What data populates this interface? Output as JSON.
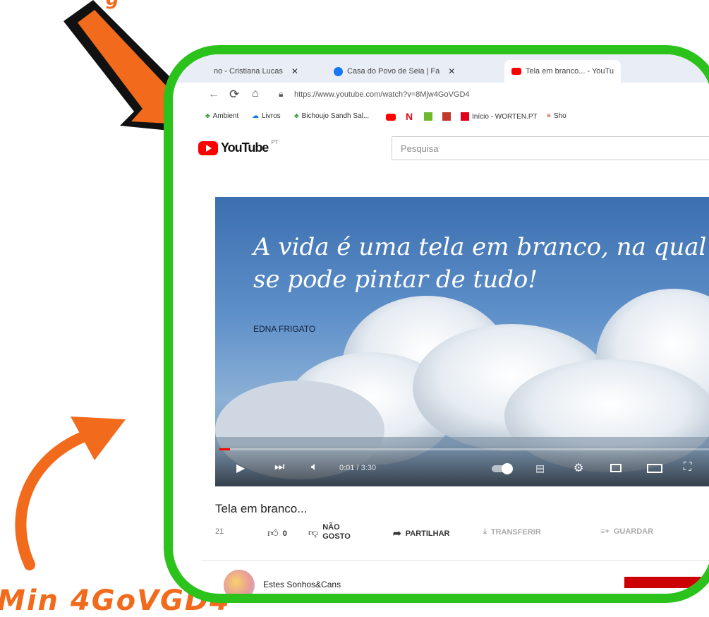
{
  "annotations": {
    "top_partial_text": "g",
    "bottom_text": "Min 4GoVGD4"
  },
  "colors": {
    "frame": "#2bc21c",
    "arrow": "#f26a1b",
    "arrow_outline": "#111111",
    "yt_red": "#ff0000"
  },
  "browser": {
    "tabs": [
      {
        "label": "no - Cristiana Lucas",
        "icon": "tab-icon"
      },
      {
        "label": "Casa do Povo de Seia | Fa",
        "icon": "facebook-icon"
      },
      {
        "label": "Tela em branco... - YouTu",
        "icon": "youtube-icon"
      }
    ],
    "url": "https://www.youtube.com/watch?v=8Mjw4GoVGD4",
    "bookmarks": [
      "Ambient",
      "Livros",
      "Bichoujo Sandh Sal...",
      "Início - WORTEN.PT",
      "Sho"
    ]
  },
  "youtube": {
    "logo": "YouTube",
    "region": "PT",
    "search_placeholder": "Pesquisa",
    "video": {
      "quote": "A vida é uma tela em branco, na qual se pode pintar de tudo!",
      "author": "EDNA FRIGATO",
      "time": "0:01 / 3:30",
      "progress": 0.02
    },
    "title": "Tela em branco...",
    "views": "21",
    "likes": "0",
    "dislike": "NÃO GOSTO",
    "share": "PARTILHAR",
    "download": "TRANSFERIR",
    "save": "GUARDAR",
    "channel": "Estes Sonhos&Cans"
  }
}
